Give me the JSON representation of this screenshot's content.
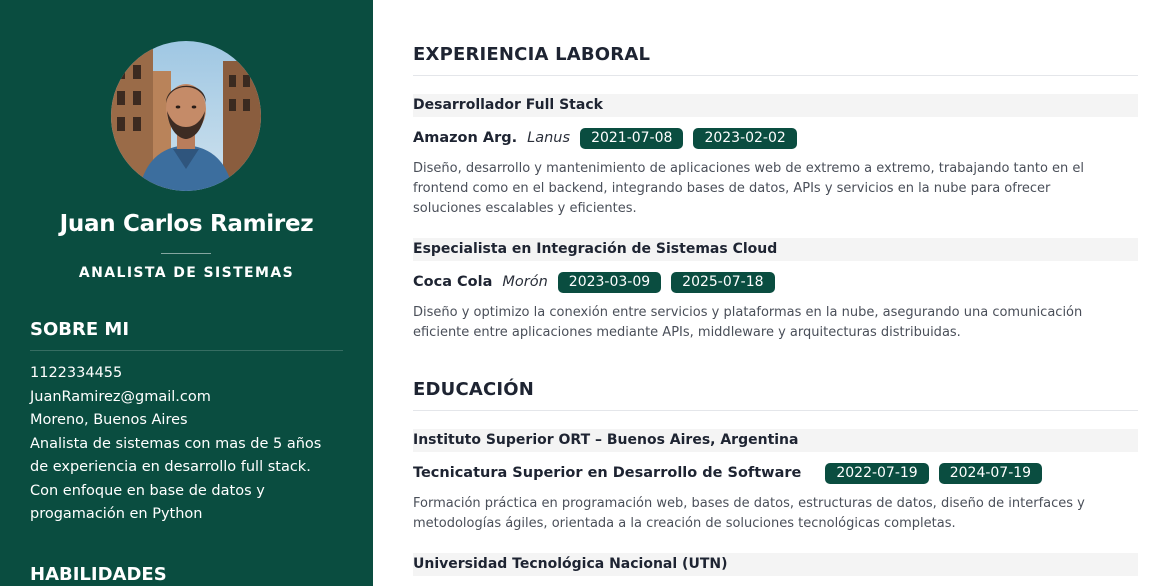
{
  "profile": {
    "name": "Juan Carlos Ramirez",
    "role": "ANALISTA DE SISTEMAS",
    "avatar_icon": "profile-photo"
  },
  "about": {
    "title": "SOBRE MI",
    "phone": "1122334455",
    "email": "JuanRamirez@gmail.com",
    "location": "Moreno, Buenos Aires",
    "summary_lines": [
      "Analista de sistemas con mas de 5 años",
      "de experiencia en desarrollo full stack.",
      "Con enfoque en base de datos y",
      "progamación en Python"
    ]
  },
  "skills": {
    "title": "HABILIDADES"
  },
  "experience": {
    "title": "EXPERIENCIA LABORAL",
    "items": [
      {
        "position": "Desarrollador Full Stack",
        "company": "Amazon Arg.",
        "location": "Lanus",
        "start": "2021-07-08",
        "end": "2023-02-02",
        "description_lines": [
          "Diseño, desarrollo y mantenimiento de aplicaciones web de extremo a extremo, trabajando tanto en el",
          "frontend como en el backend, integrando bases de datos, APIs y servicios en la nube para ofrecer",
          "soluciones escalables y eficientes."
        ]
      },
      {
        "position": "Especialista en Integración de Sistemas Cloud",
        "company": "Coca Cola",
        "location": "Morón",
        "start": "2023-03-09",
        "end": "2025-07-18",
        "description_lines": [
          "Diseño y optimizo la conexión entre servicios y plataformas en la nube, asegurando una comunicación",
          "eficiente entre aplicaciones mediante APIs, middleware y arquitecturas distribuidas."
        ]
      }
    ]
  },
  "education": {
    "title": "EDUCACIÓN",
    "items": [
      {
        "institution": "Instituto Superior ORT – Buenos Aires, Argentina",
        "degree": "Tecnicatura Superior en Desarrollo de Software",
        "start": "2022-07-19",
        "end": "2024-07-19",
        "description_lines": [
          "Formación práctica en programación web, bases de datos, estructuras de datos, diseño de interfaces y",
          "metodologías ágiles, orientada a la creación de soluciones tecnológicas completas."
        ]
      },
      {
        "institution": "Universidad Tecnológica Nacional (UTN)"
      }
    ]
  },
  "colors": {
    "sidebar": "#0a4d40",
    "tag": "#0a4d40",
    "heading": "#1e2432",
    "body_text": "#4a4f59"
  }
}
